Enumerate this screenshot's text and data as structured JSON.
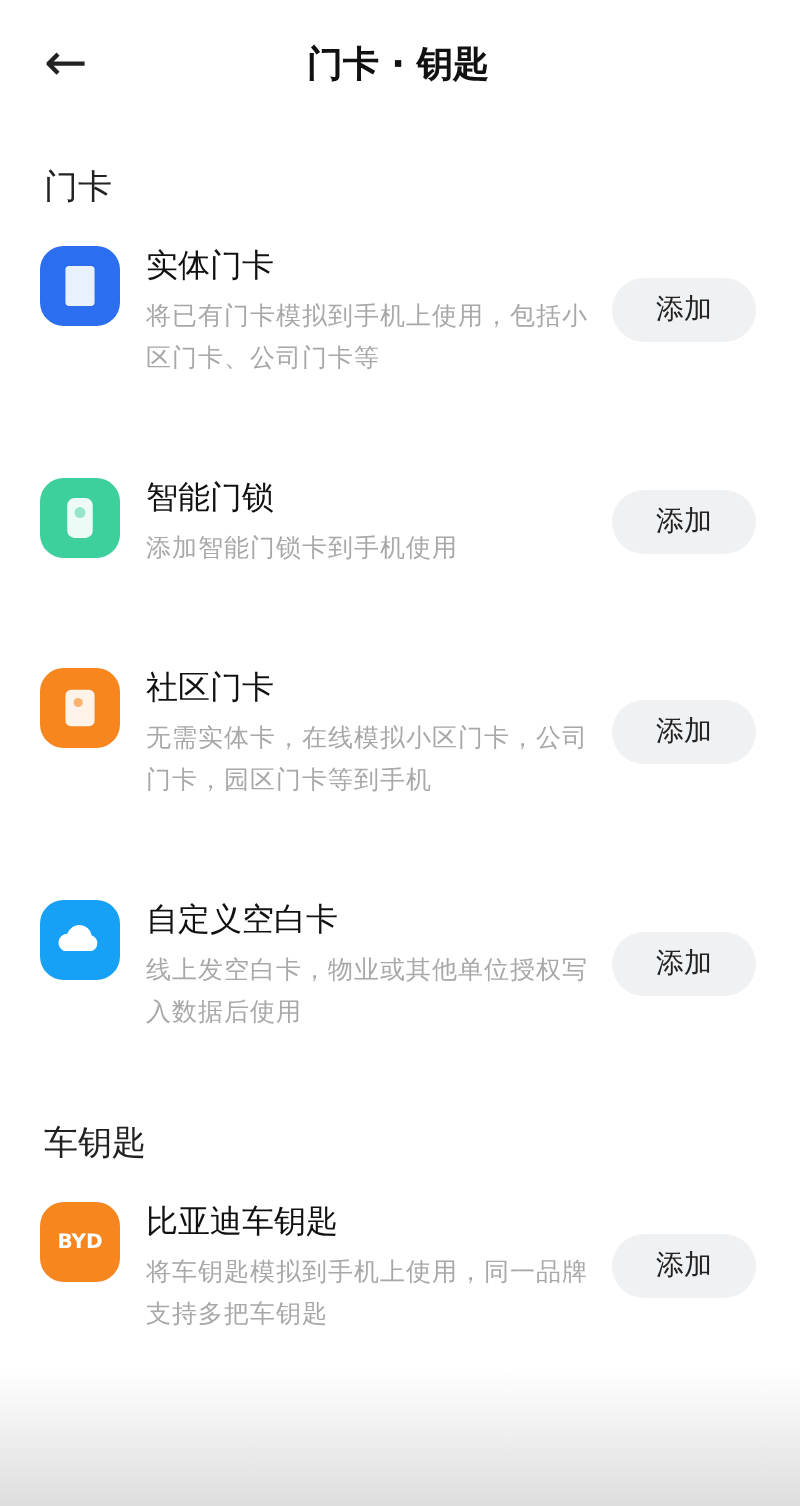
{
  "header": {
    "back": "←",
    "title": "门卡 · 钥匙"
  },
  "sections": [
    {
      "title": "门卡",
      "items": [
        {
          "kind": "card",
          "color": "#2b6ef0",
          "title": "实体门卡",
          "description": "将已有门卡模拟到手机上使用，包括小区门卡、公司门卡等",
          "button": "添加"
        },
        {
          "kind": "lock",
          "color": "#3dcf9c",
          "title": "智能门锁",
          "description": "添加智能门锁卡到手机使用",
          "button": "添加"
        },
        {
          "kind": "community",
          "color": "#f7861f",
          "title": "社区门卡",
          "description": "无需实体卡，在线模拟小区门卡，公司门卡，园区门卡等到手机",
          "button": "添加"
        },
        {
          "kind": "cloud",
          "color": "#17a1f6",
          "title": "自定义空白卡",
          "description": "线上发空白卡，物业或其他单位授权写入数据后使用",
          "button": "添加"
        }
      ]
    },
    {
      "title": "车钥匙",
      "items": [
        {
          "kind": "logo",
          "color": "#f7861f",
          "logo_text": "BYD",
          "title": "比亚迪车钥匙",
          "description": "将车钥匙模拟到手机上使用，同一品牌支持多把车钥匙",
          "button": "添加"
        }
      ]
    }
  ]
}
